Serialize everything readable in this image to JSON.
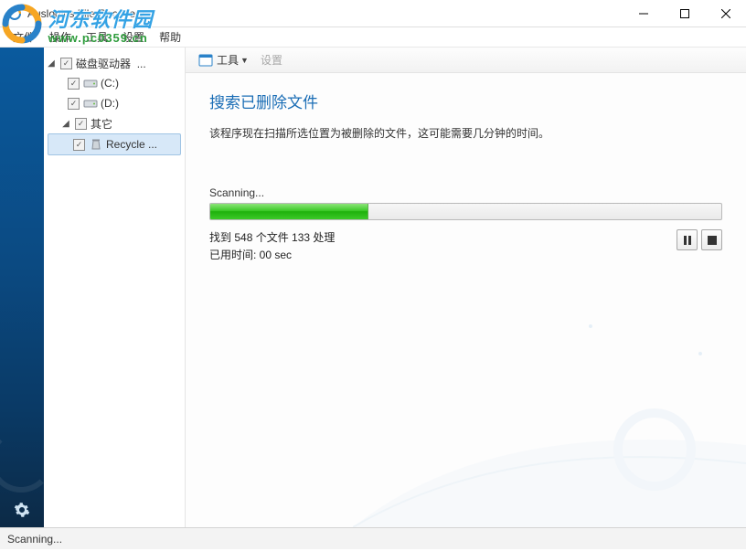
{
  "window": {
    "title": "Auslogics File Recovery"
  },
  "watermark": {
    "line1": "河东软件园",
    "line2": "www.pc0359.cn"
  },
  "menubar": {
    "items": [
      "文件",
      "操作",
      "工具",
      "设置",
      "帮助"
    ]
  },
  "tree": {
    "root1": {
      "label": "磁盘驱动器",
      "suffix": "..."
    },
    "drive1": "(C:)",
    "drive2": "(D:)",
    "root2": "其它",
    "recycle": "Recycle ..."
  },
  "toolbar": {
    "tools": "工具",
    "settings": "设置"
  },
  "scan": {
    "heading": "搜索已删除文件",
    "desc": "该程序现在扫描所选位置为被删除的文件，这可能需要几分钟的时间。",
    "scanning": "Scanning...",
    "found_prefix": "找到 ",
    "found_count": "548",
    "found_mid": " 个文件 ",
    "processed": "133",
    "found_suffix": " 处理",
    "elapsed_label": "已用时间: ",
    "elapsed_value": "00 sec"
  },
  "statusbar": {
    "text": "Scanning..."
  }
}
